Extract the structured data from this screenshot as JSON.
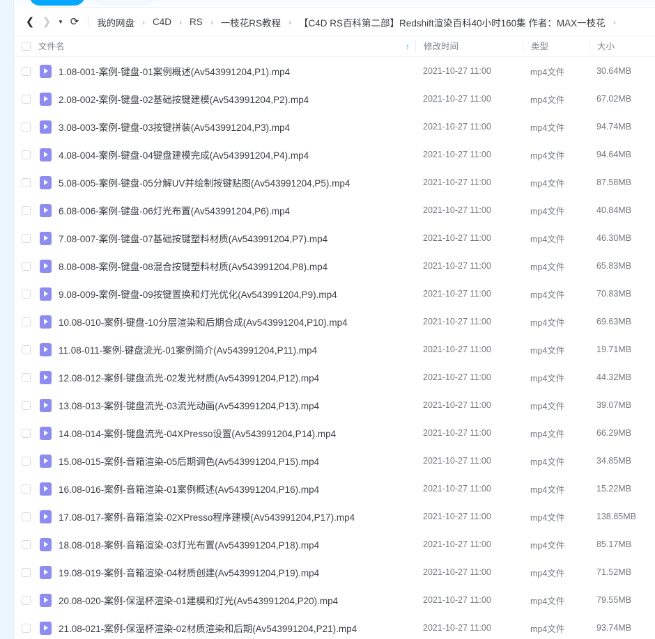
{
  "toolbar": {
    "primary_button_label": "",
    "secondary_button_label": ""
  },
  "navigation": {
    "back_icon": "chevron-left-icon",
    "forward_icon": "chevron-right-icon",
    "history_icon": "caret-down-icon",
    "refresh_icon": "refresh-icon"
  },
  "breadcrumb": {
    "separator": "›",
    "items": [
      "我的网盘",
      "C4D",
      "RS",
      "一枝花RS教程",
      "【C4D RS百科第二部】Redshift渲染百科40小时160集 作者：MAX一枝花"
    ],
    "trailing_separator": "›"
  },
  "columns": {
    "select_all_label": "",
    "name": "文件名",
    "sort_indicator": "↑",
    "modified": "修改时间",
    "type": "类型",
    "size": "大小"
  },
  "files": [
    {
      "name": "1.08-001-案例-键盘-01案例概述(Av543991204,P1).mp4",
      "modified": "2021-10-27 11:00",
      "type": "mp4文件",
      "size": "30.64MB",
      "icon": "video-file-icon"
    },
    {
      "name": "2.08-002-案例-键盘-02基础按键建模(Av543991204,P2).mp4",
      "modified": "2021-10-27 11:00",
      "type": "mp4文件",
      "size": "67.02MB",
      "icon": "video-file-icon"
    },
    {
      "name": "3.08-003-案例-键盘-03按键拼装(Av543991204,P3).mp4",
      "modified": "2021-10-27 11:00",
      "type": "mp4文件",
      "size": "94.74MB",
      "icon": "video-file-icon"
    },
    {
      "name": "4.08-004-案例-键盘-04键盘建模完成(Av543991204,P4).mp4",
      "modified": "2021-10-27 11:00",
      "type": "mp4文件",
      "size": "94.64MB",
      "icon": "video-file-icon"
    },
    {
      "name": "5.08-005-案例-键盘-05分解UV并绘制按键贴图(Av543991204,P5).mp4",
      "modified": "2021-10-27 11:00",
      "type": "mp4文件",
      "size": "87.58MB",
      "icon": "video-file-icon"
    },
    {
      "name": "6.08-006-案例-键盘-06灯光布置(Av543991204,P6).mp4",
      "modified": "2021-10-27 11:00",
      "type": "mp4文件",
      "size": "40.84MB",
      "icon": "video-file-icon"
    },
    {
      "name": "7.08-007-案例-键盘-07基础按键塑料材质(Av543991204,P7).mp4",
      "modified": "2021-10-27 11:00",
      "type": "mp4文件",
      "size": "46.30MB",
      "icon": "video-file-icon"
    },
    {
      "name": "8.08-008-案例-键盘-08混合按键塑料材质(Av543991204,P8).mp4",
      "modified": "2021-10-27 11:00",
      "type": "mp4文件",
      "size": "65.83MB",
      "icon": "video-file-icon"
    },
    {
      "name": "9.08-009-案例-键盘-09按键置换和灯光优化(Av543991204,P9).mp4",
      "modified": "2021-10-27 11:00",
      "type": "mp4文件",
      "size": "70.83MB",
      "icon": "video-file-icon"
    },
    {
      "name": "10.08-010-案例-键盘-10分层渲染和后期合成(Av543991204,P10).mp4",
      "modified": "2021-10-27 11:00",
      "type": "mp4文件",
      "size": "69.63MB",
      "icon": "video-file-icon"
    },
    {
      "name": "11.08-011-案例-键盘流光-01案例简介(Av543991204,P11).mp4",
      "modified": "2021-10-27 11:00",
      "type": "mp4文件",
      "size": "19.71MB",
      "icon": "video-file-icon"
    },
    {
      "name": "12.08-012-案例-键盘流光-02发光材质(Av543991204,P12).mp4",
      "modified": "2021-10-27 11:00",
      "type": "mp4文件",
      "size": "44.32MB",
      "icon": "video-file-icon"
    },
    {
      "name": "13.08-013-案例-键盘流光-03流光动画(Av543991204,P13).mp4",
      "modified": "2021-10-27 11:00",
      "type": "mp4文件",
      "size": "39.07MB",
      "icon": "video-file-icon"
    },
    {
      "name": "14.08-014-案例-键盘流光-04XPresso设置(Av543991204,P14).mp4",
      "modified": "2021-10-27 11:00",
      "type": "mp4文件",
      "size": "66.29MB",
      "icon": "video-file-icon"
    },
    {
      "name": "15.08-015-案例-音箱渲染-05后期调色(Av543991204,P15).mp4",
      "modified": "2021-10-27 11:00",
      "type": "mp4文件",
      "size": "34.85MB",
      "icon": "video-file-icon"
    },
    {
      "name": "16.08-016-案例-音箱渲染-01案例概述(Av543991204,P16).mp4",
      "modified": "2021-10-27 11:00",
      "type": "mp4文件",
      "size": "15.22MB",
      "icon": "video-file-icon"
    },
    {
      "name": "17.08-017-案例-音箱渲染-02XPresso程序建模(Av543991204,P17).mp4",
      "modified": "2021-10-27 11:00",
      "type": "mp4文件",
      "size": "138.85MB",
      "icon": "video-file-icon"
    },
    {
      "name": "18.08-018-案例-音箱渲染-03灯光布置(Av543991204,P18).mp4",
      "modified": "2021-10-27 11:00",
      "type": "mp4文件",
      "size": "85.17MB",
      "icon": "video-file-icon"
    },
    {
      "name": "19.08-019-案例-音箱渲染-04材质创建(Av543991204,P19).mp4",
      "modified": "2021-10-27 11:00",
      "type": "mp4文件",
      "size": "71.52MB",
      "icon": "video-file-icon"
    },
    {
      "name": "20.08-020-案例-保温杯渲染-01建模和灯光(Av543991204,P20).mp4",
      "modified": "2021-10-27 11:00",
      "type": "mp4文件",
      "size": "79.55MB",
      "icon": "video-file-icon"
    },
    {
      "name": "21.08-021-案例-保温杯渲染-02材质渲染和后期(Av543991204,P21).mp4",
      "modified": "2021-10-27 11:00",
      "type": "mp4文件",
      "size": "93.74MB",
      "icon": "video-file-icon"
    }
  ],
  "colors": {
    "accent_blue": "#06a7ff",
    "sort_blue": "#2ba8e8",
    "video_icon_purple": "#8d8cf0",
    "rail_blue": "#eef6fd",
    "text_primary": "#3b3f44",
    "text_secondary": "#73787e"
  }
}
